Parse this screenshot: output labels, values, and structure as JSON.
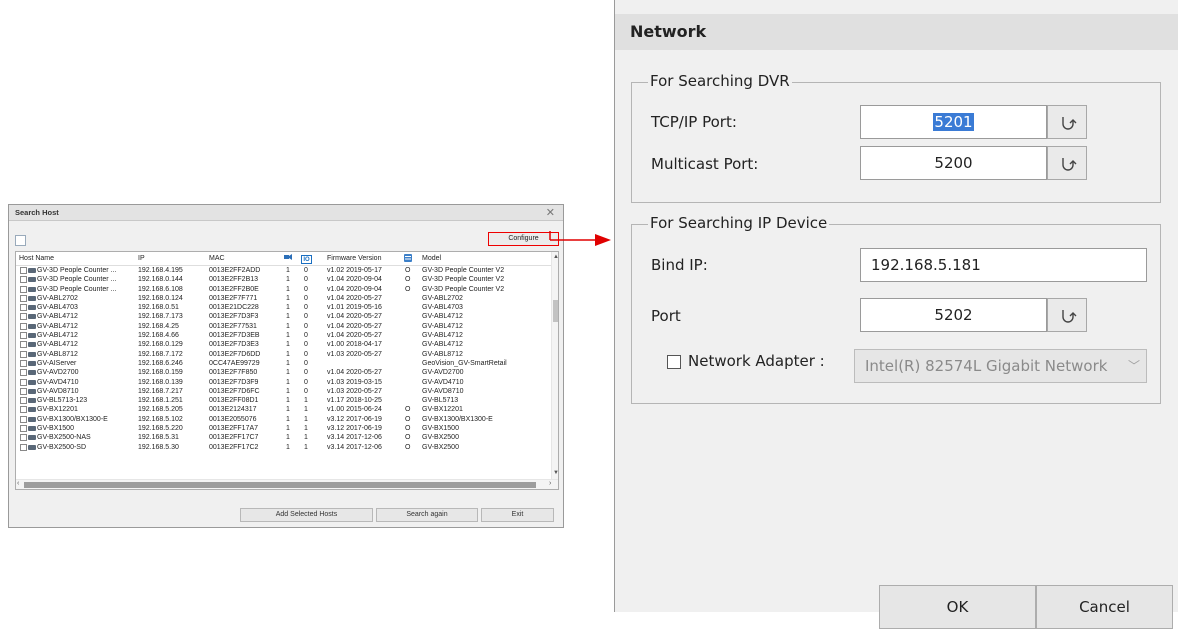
{
  "search_host": {
    "title": "Search Host",
    "close_glyph": "✕",
    "configure_label": "Configure",
    "columns": {
      "host_name": "Host Name",
      "ip": "IP",
      "mac": "MAC",
      "col_video": "",
      "col_io": "IO",
      "firmware": "Firmware Version",
      "col_db": "",
      "model": "Model"
    },
    "rows": [
      {
        "host": "GV-3D People Counter ...",
        "ip": "192.168.4.195",
        "mac": "0013E2FF2ADD",
        "v": "1",
        "io": "0",
        "fw": "v1.02 2019-05-17",
        "db": "O",
        "model": "GV-3D People Counter V2"
      },
      {
        "host": "GV-3D People Counter ...",
        "ip": "192.168.0.144",
        "mac": "0013E2FF2B13",
        "v": "1",
        "io": "0",
        "fw": "v1.04 2020-09-04",
        "db": "O",
        "model": "GV-3D People Counter V2"
      },
      {
        "host": "GV-3D People Counter ...",
        "ip": "192.168.6.108",
        "mac": "0013E2FF2B0E",
        "v": "1",
        "io": "0",
        "fw": "v1.04 2020-09-04",
        "db": "O",
        "model": "GV-3D People Counter V2"
      },
      {
        "host": "GV-ABL2702",
        "ip": "192.168.0.124",
        "mac": "0013E2F7F771",
        "v": "1",
        "io": "0",
        "fw": "v1.04 2020-05-27",
        "db": "",
        "model": "GV-ABL2702"
      },
      {
        "host": "GV-ABL4703",
        "ip": "192.168.0.51",
        "mac": "0013E21DC228",
        "v": "1",
        "io": "0",
        "fw": "v1.01 2019-05-16",
        "db": "",
        "model": "GV-ABL4703"
      },
      {
        "host": "GV-ABL4712",
        "ip": "192.168.7.173",
        "mac": "0013E2F7D3F3",
        "v": "1",
        "io": "0",
        "fw": "v1.04 2020-05-27",
        "db": "",
        "model": "GV-ABL4712"
      },
      {
        "host": "GV-ABL4712",
        "ip": "192.168.4.25",
        "mac": "0013E2F77531",
        "v": "1",
        "io": "0",
        "fw": "v1.04 2020-05-27",
        "db": "",
        "model": "GV-ABL4712"
      },
      {
        "host": "GV-ABL4712",
        "ip": "192.168.4.66",
        "mac": "0013E2F7D3EB",
        "v": "1",
        "io": "0",
        "fw": "v1.04 2020-05-27",
        "db": "",
        "model": "GV-ABL4712"
      },
      {
        "host": "GV-ABL4712",
        "ip": "192.168.0.129",
        "mac": "0013E2F7D3E3",
        "v": "1",
        "io": "0",
        "fw": "v1.00 2018-04-17",
        "db": "",
        "model": "GV-ABL4712"
      },
      {
        "host": "GV-ABL8712",
        "ip": "192.168.7.172",
        "mac": "0013E2F7D6DD",
        "v": "1",
        "io": "0",
        "fw": "v1.03 2020-05-27",
        "db": "",
        "model": "GV-ABL8712"
      },
      {
        "host": "GV-AIServer",
        "ip": "192.168.6.246",
        "mac": "0CC47AE99729",
        "v": "1",
        "io": "0",
        "fw": "",
        "db": "",
        "model": "GeoVision_GV-SmartRetail"
      },
      {
        "host": "GV-AVD2700",
        "ip": "192.168.0.159",
        "mac": "0013E2F7F850",
        "v": "1",
        "io": "0",
        "fw": "v1.04 2020-05-27",
        "db": "",
        "model": "GV-AVD2700"
      },
      {
        "host": "GV-AVD4710",
        "ip": "192.168.0.139",
        "mac": "0013E2F7D3F9",
        "v": "1",
        "io": "0",
        "fw": "v1.03 2019-03-15",
        "db": "",
        "model": "GV-AVD4710"
      },
      {
        "host": "GV-AVD8710",
        "ip": "192.168.7.217",
        "mac": "0013E2F7D6FC",
        "v": "1",
        "io": "0",
        "fw": "v1.03 2020-05-27",
        "db": "",
        "model": "GV-AVD8710"
      },
      {
        "host": "GV-BL5713-123",
        "ip": "192.168.1.251",
        "mac": "0013E2FF08D1",
        "v": "1",
        "io": "1",
        "fw": "v1.17 2018-10-25",
        "db": "",
        "model": "GV-BL5713"
      },
      {
        "host": "GV-BX12201",
        "ip": "192.168.5.205",
        "mac": "0013E2124317",
        "v": "1",
        "io": "1",
        "fw": "v1.00 2015-06-24",
        "db": "O",
        "model": "GV-BX12201"
      },
      {
        "host": "GV-BX1300/BX1300-E",
        "ip": "192.168.5.102",
        "mac": "0013E2055076",
        "v": "1",
        "io": "1",
        "fw": "v3.12 2017-06-19",
        "db": "O",
        "model": "GV-BX1300/BX1300-E"
      },
      {
        "host": "GV-BX1500",
        "ip": "192.168.5.220",
        "mac": "0013E2FF17A7",
        "v": "1",
        "io": "1",
        "fw": "v3.12 2017-06-19",
        "db": "O",
        "model": "GV-BX1500"
      },
      {
        "host": "GV-BX2500-NAS",
        "ip": "192.168.5.31",
        "mac": "0013E2FF17C7",
        "v": "1",
        "io": "1",
        "fw": "v3.14 2017-12-06",
        "db": "O",
        "model": "GV-BX2500"
      },
      {
        "host": "GV-BX2500-SD",
        "ip": "192.168.5.30",
        "mac": "0013E2FF17C2",
        "v": "1",
        "io": "1",
        "fw": "v3.14 2017-12-06",
        "db": "O",
        "model": "GV-BX2500"
      }
    ],
    "add_selected_label": "Add Selected Hosts",
    "search_again_label": "Search again",
    "exit_label": "Exit"
  },
  "network": {
    "title": "Network",
    "dvr_group_label": "For Searching DVR",
    "tcpip_label": "TCP/IP Port:",
    "tcpip_value": "5201",
    "multicast_label": "Multicast Port:",
    "multicast_value": "5200",
    "ip_group_label": "For Searching IP Device",
    "bind_ip_label": "Bind IP:",
    "bind_ip_value": "192.168.5.181",
    "port_label": "Port",
    "port_value": "5202",
    "adapter_label": "Network Adapter :",
    "adapter_value": "Intel(R) 82574L Gigabit Network",
    "ok_label": "OK",
    "cancel_label": "Cancel"
  },
  "colors": {
    "highlight_red": "#e00000",
    "selection_blue": "#3a7bd5",
    "io_blue": "#1a6fc2"
  },
  "icons": [
    "close-icon",
    "camera-icon",
    "reset-icon",
    "dropdown-arrow-icon",
    "arrow-right-icon",
    "database-icon",
    "video-icon"
  ]
}
